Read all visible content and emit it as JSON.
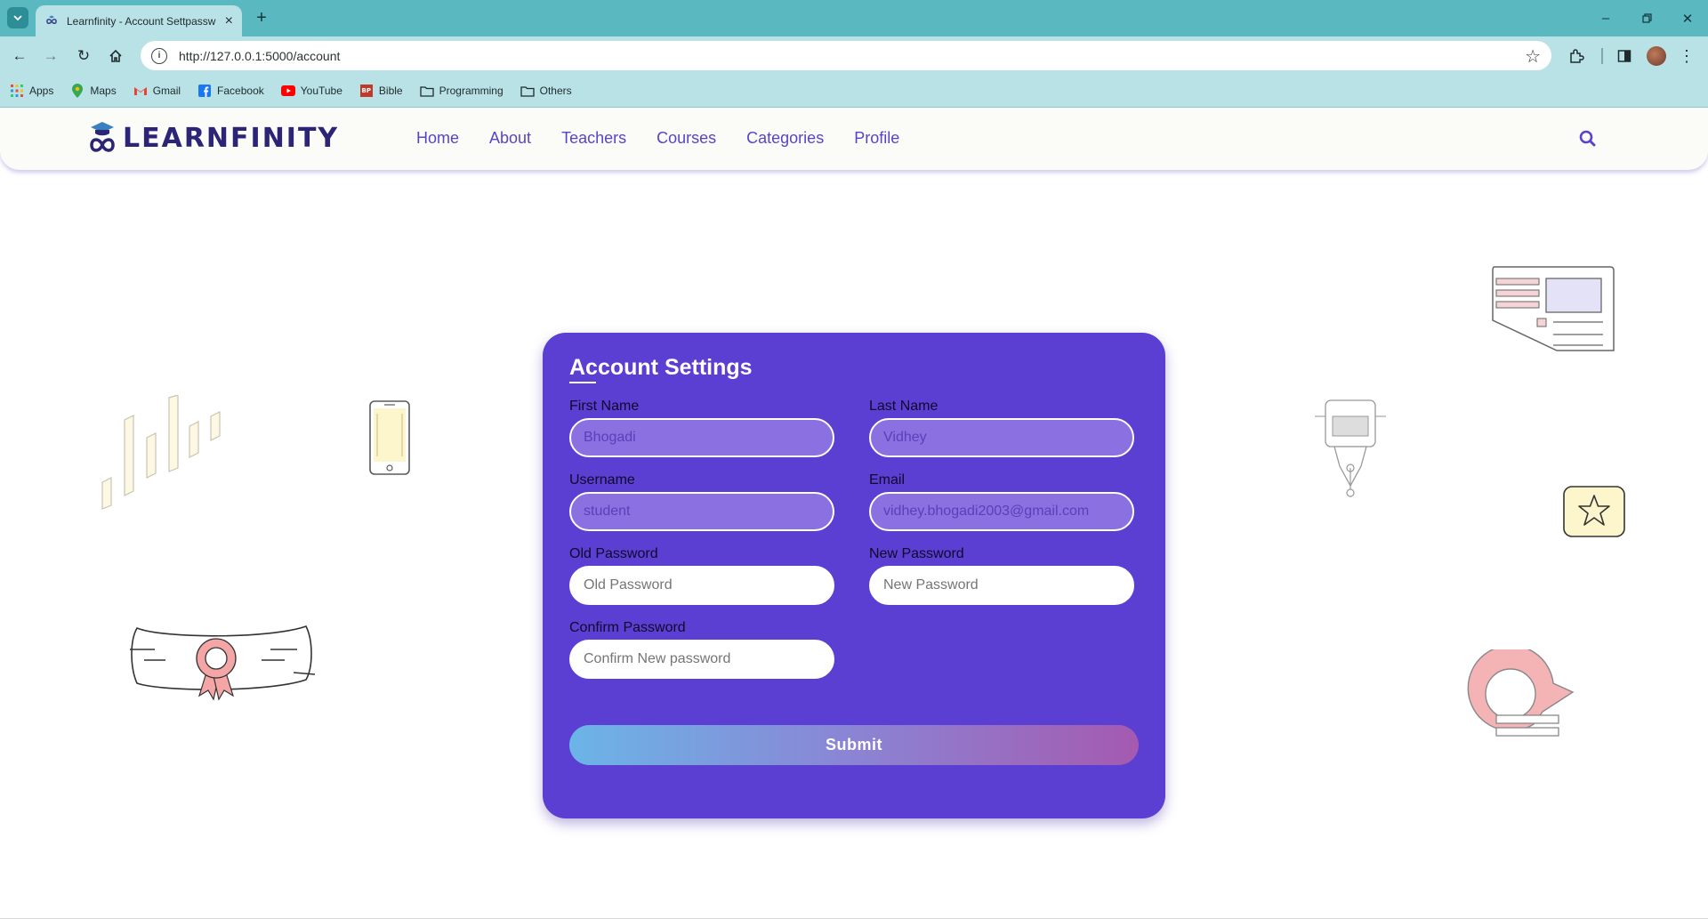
{
  "browser": {
    "tab_title": "Learnfinity - Account Settpassw",
    "url": "http://127.0.0.1:5000/account",
    "bookmarks": [
      "Apps",
      "Maps",
      "Gmail",
      "Facebook",
      "YouTube",
      "Bible",
      "Programming",
      "Others"
    ]
  },
  "site": {
    "logo_text": "LEARNFINITY",
    "nav": [
      "Home",
      "About",
      "Teachers",
      "Courses",
      "Categories",
      "Profile"
    ]
  },
  "form": {
    "title": "Account Settings",
    "fields": {
      "first_name": {
        "label": "First Name",
        "value": "Bhogadi"
      },
      "last_name": {
        "label": "Last Name",
        "value": "Vidhey"
      },
      "username": {
        "label": "Username",
        "value": "student"
      },
      "email": {
        "label": "Email",
        "value": "vidhey.bhogadi2003@gmail.com"
      },
      "old_password": {
        "label": "Old Password",
        "placeholder": "Old Password"
      },
      "new_password": {
        "label": "New Password",
        "placeholder": "New Password"
      },
      "confirm_password": {
        "label": "Confirm Password",
        "placeholder": "Confirm New password"
      }
    },
    "submit_label": "Submit"
  },
  "colors": {
    "card": "#5b3ed2",
    "nav_link": "#5b43c9",
    "browser_frame": "#5ab8c0",
    "toolbar": "#b8e2e6"
  }
}
